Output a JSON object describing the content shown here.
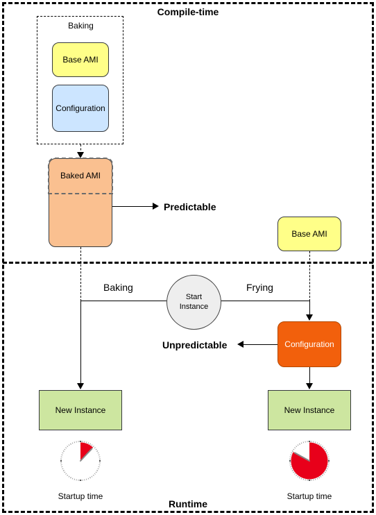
{
  "diagram": {
    "sections": {
      "compile_time": "Compile-time",
      "runtime": "Runtime"
    },
    "groups": {
      "baking": "Baking"
    },
    "compile_time_nodes": {
      "base_ami": "Base AMI",
      "configuration": "Configuration",
      "baked_ami": "Baked AMI",
      "base_ami_right": "Base AMI"
    },
    "runtime_nodes": {
      "start_instance": "Start\nInstance",
      "start_instance_line1": "Start",
      "start_instance_line2": "Instance",
      "configuration": "Configuration",
      "new_instance_left": "New Instance",
      "new_instance_right": "New Instance"
    },
    "edge_labels": {
      "baking": "Baking",
      "frying": "Frying"
    },
    "outcomes": {
      "predictable": "Predictable",
      "unpredictable": "Unpredictable"
    },
    "captions": {
      "startup_time_left": "Startup time",
      "startup_time_right": "Startup time"
    },
    "stopwatches": {
      "left": {
        "fill_percent": 12,
        "fill_color": "#e8001a",
        "face_color": "#ffffff"
      },
      "right": {
        "fill_percent": 83,
        "fill_color": "#e8001a",
        "face_color": "#ffffff"
      }
    },
    "colors": {
      "base_ami": "#ffff88",
      "configuration_compile": "#cce5ff",
      "baked_ami": "#fac090",
      "configuration_runtime": "#f2600c",
      "new_instance": "#cde6a0",
      "start_instance": "#eeeeee",
      "border": "#36393d",
      "stroke": "#000000"
    }
  }
}
